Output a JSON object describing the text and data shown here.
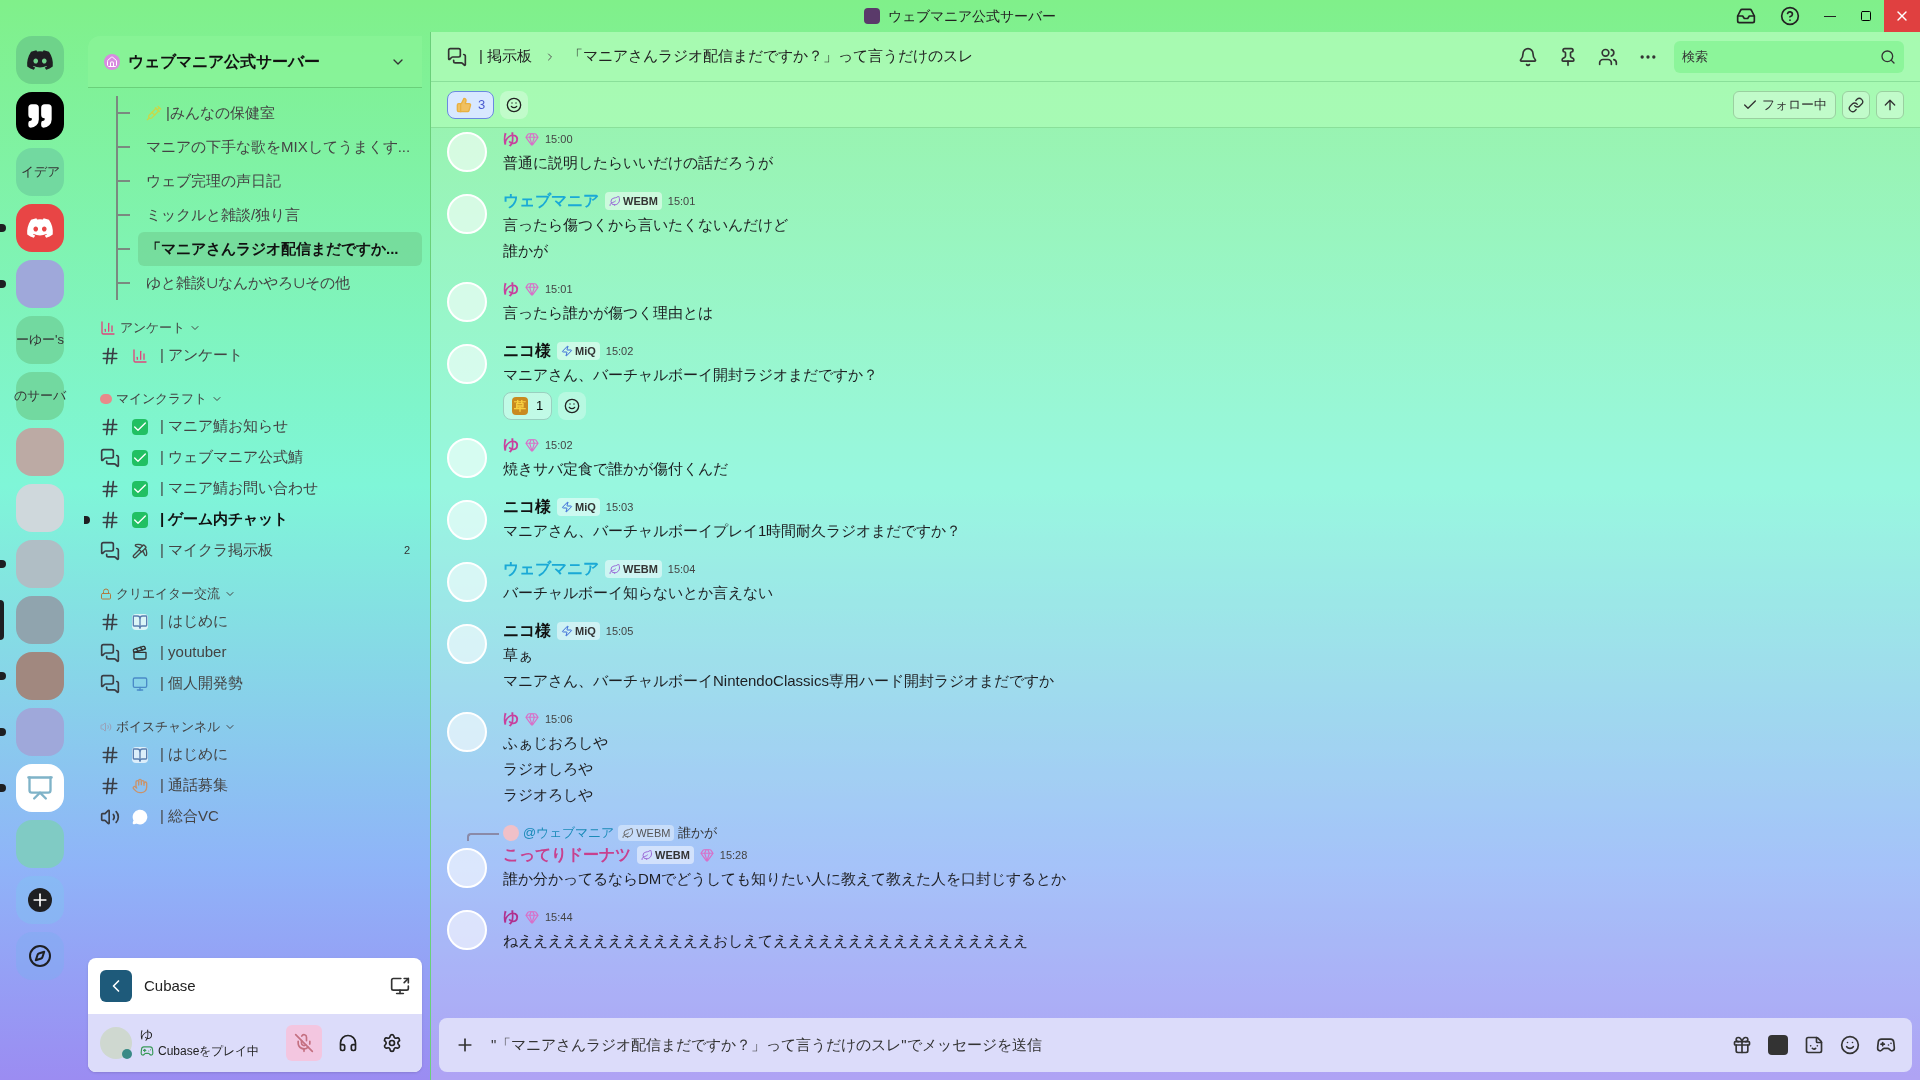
{
  "window": {
    "title": "ウェブマニア公式サーバー"
  },
  "servers": [
    {
      "kind": "logo",
      "unread": false,
      "selected": false
    },
    {
      "kind": "quote",
      "unread": false,
      "selected": false
    },
    {
      "kind": "text",
      "label": "イデア",
      "unread": false,
      "selected": false
    },
    {
      "kind": "discord",
      "unread": true,
      "selected": false
    },
    {
      "kind": "photo",
      "unread": true,
      "selected": false
    },
    {
      "kind": "text",
      "label": "ーゆー's",
      "unread": false,
      "selected": false
    },
    {
      "kind": "text",
      "label": "のサーバ",
      "unread": false,
      "selected": false
    },
    {
      "kind": "photo",
      "unread": false,
      "selected": false
    },
    {
      "kind": "photo",
      "unread": false,
      "selected": false
    },
    {
      "kind": "photo",
      "unread": true,
      "selected": false
    },
    {
      "kind": "photo",
      "unread": false,
      "selected": true
    },
    {
      "kind": "photo",
      "unread": true,
      "selected": false
    },
    {
      "kind": "photo",
      "unread": true,
      "selected": false
    },
    {
      "kind": "easel",
      "unread": true,
      "selected": false
    },
    {
      "kind": "photo",
      "unread": false,
      "selected": false
    },
    {
      "kind": "add",
      "unread": false,
      "selected": false
    },
    {
      "kind": "explore",
      "unread": false,
      "selected": false
    }
  ],
  "sidebar": {
    "server_name": "ウェブマニア公式サーバー",
    "threads": [
      {
        "name": "|みんなの保健室",
        "selected": false
      },
      {
        "name": "マニアの下手な歌をMIXしてうまくす...",
        "selected": false
      },
      {
        "name": "ウェブ完理の声日記",
        "selected": false
      },
      {
        "name": "ミックルと雑談/独り言",
        "selected": false
      },
      {
        "name": "「マニアさんラジオ配信まだですか...",
        "selected": true
      },
      {
        "name": "ゆと雑談∪なんかやろ∪その他",
        "selected": false
      }
    ],
    "categories": [
      {
        "name": "アンケート",
        "channels": [
          {
            "kind": "text",
            "name": "| アンケート",
            "unread": false
          }
        ]
      },
      {
        "name": "マインクラフト",
        "channels": [
          {
            "kind": "text",
            "name": "| マニア鯖お知らせ",
            "unread": false
          },
          {
            "kind": "forum",
            "name": "| ウェブマニア公式鯖",
            "unread": false
          },
          {
            "kind": "text",
            "name": "| マニア鯖お問い合わせ",
            "unread": false
          },
          {
            "kind": "text",
            "name": "| ゲーム内チャット",
            "unread": true
          },
          {
            "kind": "forum",
            "name": "| マイクラ掲示板",
            "unread": false,
            "badge": "2"
          }
        ]
      },
      {
        "name": "クリエイター交流",
        "channels": [
          {
            "kind": "text",
            "name": "| はじめに",
            "unread": false
          },
          {
            "kind": "forum",
            "name": "| youtuber",
            "unread": false
          },
          {
            "kind": "forum",
            "name": "| 個人開発勢",
            "unread": false
          }
        ]
      },
      {
        "name": "ボイスチャンネル",
        "channels": [
          {
            "kind": "text",
            "name": "| はじめに",
            "unread": false
          },
          {
            "kind": "text",
            "name": "| 通話募集",
            "unread": false
          },
          {
            "kind": "voice",
            "name": "| 総合VC",
            "unread": false
          }
        ]
      }
    ]
  },
  "activity": {
    "app": "Cubase"
  },
  "user": {
    "name": "ゆ",
    "status": "Cubaseをプレイ中",
    "muted": true
  },
  "header": {
    "forum": "| 掲示板",
    "thread": "「マニアさんラジオ配信まだですか？」って言うだけのスレ",
    "search": {
      "placeholder": "検索"
    }
  },
  "thread_bar": {
    "reaction_count": "3",
    "follow": "フォロー中"
  },
  "messages": [
    {
      "author": "ゆ",
      "color": "#c8409e",
      "gem": true,
      "time": "15:00",
      "lines": [
        "普通に説明したらいいだけの話だろうが"
      ]
    },
    {
      "author": "ウェブマニア",
      "color": "#1aa9d6",
      "tag": {
        "text": "WEBM",
        "kind": "leaf"
      },
      "time": "15:01",
      "lines": [
        "言ったら傷つくから言いたくないんだけど",
        "誰かが"
      ]
    },
    {
      "author": "ゆ",
      "color": "#c8409e",
      "gem": true,
      "time": "15:01",
      "lines": [
        "言ったら誰かが傷つく理由とは"
      ]
    },
    {
      "author": "ニコ様",
      "color": "#111111",
      "tag": {
        "text": "MiQ",
        "kind": "bolt"
      },
      "time": "15:02",
      "lines": [
        "マニアさん、バーチャルボーイ開封ラジオまだですか？"
      ],
      "reactions": [
        {
          "emoji": "草",
          "count": "1"
        }
      ]
    },
    {
      "author": "ゆ",
      "color": "#c8409e",
      "gem": true,
      "time": "15:02",
      "lines": [
        "焼きサバ定食で誰かが傷付くんだ"
      ]
    },
    {
      "author": "ニコ様",
      "color": "#111111",
      "tag": {
        "text": "MiQ",
        "kind": "bolt"
      },
      "time": "15:03",
      "lines": [
        "マニアさん、バーチャルボーイプレイ1時間耐久ラジオまだですか？"
      ]
    },
    {
      "author": "ウェブマニア",
      "color": "#1aa9d6",
      "tag": {
        "text": "WEBM",
        "kind": "leaf"
      },
      "time": "15:04",
      "lines": [
        "バーチャルボーイ知らないとか言えない"
      ]
    },
    {
      "author": "ニコ様",
      "color": "#111111",
      "tag": {
        "text": "MiQ",
        "kind": "bolt"
      },
      "time": "15:05",
      "lines": [
        "草ぁ",
        "マニアさん、バーチャルボーイNintendoClassics専用ハード開封ラジオまだですか"
      ]
    },
    {
      "author": "ゆ",
      "color": "#c8409e",
      "gem": true,
      "time": "15:06",
      "lines": [
        "ふぁじおろしや",
        "ラジオしろや",
        "ラジオろしや"
      ]
    },
    {
      "author": "こってりドーナツ",
      "color": "#c8408e",
      "tag": {
        "text": "WEBM",
        "kind": "leaf"
      },
      "gem": true,
      "time": "15:28",
      "reply": {
        "author": "@ウェブマニア",
        "color": "#1a8ab8",
        "tag": "WEBM",
        "text": "誰かが"
      },
      "lines": [
        "誰か分かってるならDMでどうしても知りたい人に教えて教えた人を口封じするとか"
      ]
    },
    {
      "author": "ゆ",
      "color": "#b0308e",
      "gem": true,
      "time": "15:44",
      "lines": [
        "ねえええええええええええええおしえてえええええええええええええええええ"
      ]
    }
  ],
  "composer": {
    "placeholder": "\"「マニアさんラジオ配信まだですか？」って言うだけのスレ\"でメッセージを送信"
  }
}
